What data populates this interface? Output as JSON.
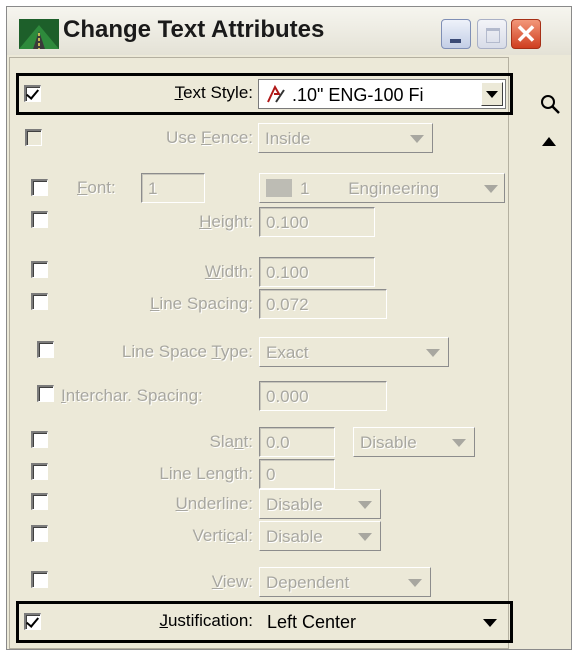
{
  "window": {
    "title": "Change Text Attributes"
  },
  "text_style": {
    "checked": true,
    "label_hot": "T",
    "label_rest": "ext Style:",
    "value": ".10\"  ENG-100 Fi"
  },
  "use_fence": {
    "label_pre": "Use ",
    "label_hot": "F",
    "label_rest": "ence:",
    "value": "Inside"
  },
  "font": {
    "label_hot": "F",
    "label_rest": "ont:",
    "number": "1",
    "preview_number": "1",
    "name": "Engineering"
  },
  "height": {
    "label_hot": "H",
    "label_rest": "eight:",
    "value": "0.100"
  },
  "width": {
    "label_hot": "W",
    "label_rest": "idth:",
    "value": "0.100"
  },
  "line_spacing": {
    "label_hot": "L",
    "label_rest": "ine Spacing:",
    "value": "0.072"
  },
  "line_space_type": {
    "label_pre": "Line Space ",
    "label_hot": "T",
    "label_rest": "ype:",
    "value": "Exact"
  },
  "interchar_spacing": {
    "label_hot": "I",
    "label_rest": "nterchar. Spacing:",
    "value": "0.000"
  },
  "slant": {
    "label_pre": "Sla",
    "label_hot": "n",
    "label_rest": "t:",
    "value": "0.0",
    "mode": "Disable"
  },
  "line_length": {
    "label_pre": "Line Len",
    "label_hot": "g",
    "label_rest": "th:",
    "value": "0"
  },
  "underline": {
    "label_hot": "U",
    "label_rest": "nderline:",
    "value": "Disable"
  },
  "vertical": {
    "label_pre": "Verti",
    "label_hot": "c",
    "label_rest": "al:",
    "value": "Disable"
  },
  "view": {
    "label_hot": "V",
    "label_rest": "iew:",
    "value": "Dependent"
  },
  "justification": {
    "checked": true,
    "label_hot": "J",
    "label_rest": "ustification:",
    "value": "Left Center"
  },
  "colors": {
    "dialog_bg": "#ece9d8",
    "disabled_text": "#a8a7a0",
    "close_red": "#cf3e20"
  }
}
